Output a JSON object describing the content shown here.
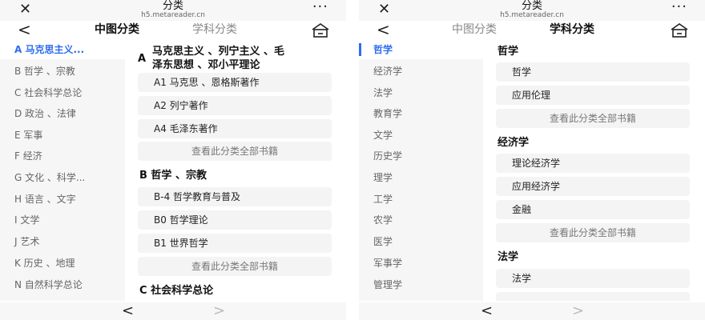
{
  "top": {
    "close_glyph": "✕",
    "title": "分类",
    "url": "h5.metareader.cn",
    "more_glyph": "···"
  },
  "nav": {
    "back_glyph": "<",
    "tab_cn": "中图分类",
    "tab_subject": "学科分类",
    "home_icon": "home-icon"
  },
  "bottom": {
    "prev_glyph": "<",
    "next_glyph": ">"
  },
  "left": {
    "sidebar": [
      "A 马克思主义...",
      "B 哲学 、宗教",
      "C 社会科学总论",
      "D 政治 、法律",
      "E 军事",
      "F 经济",
      "G 文化 、科学...",
      "H 语言 、文字",
      "I 文学",
      "J 艺术",
      "K 历史 、地理",
      "N 自然科学总论"
    ],
    "sec_a_line1": "马克思主义 、列宁主义 、毛",
    "sec_a_line2": "泽东思想 、邓小平理论",
    "sec_a_letter": "A",
    "sec_a_items": [
      "A1 马克思 、恩格斯著作",
      "A2 列宁著作",
      "A4 毛泽东著作"
    ],
    "view_all": "查看此分类全部书籍",
    "sec_b_title": "B 哲学 、宗教",
    "sec_b_items": [
      "B-4 哲学教育与普及",
      "B0 哲学理论",
      "B1 世界哲学"
    ],
    "sec_c_title": "C 社会科学总论"
  },
  "right": {
    "sidebar": [
      "哲学",
      "经济学",
      "法学",
      "教育学",
      "文学",
      "历史学",
      "理学",
      "工学",
      "农学",
      "医学",
      "军事学",
      "管理学"
    ],
    "sec1_title": "哲学",
    "sec1_items": [
      "哲学",
      "应用伦理"
    ],
    "sec2_title": "经济学",
    "sec2_items": [
      "理论经济学",
      "应用经济学",
      "金融"
    ],
    "sec3_title": "法学",
    "sec3_items": [
      "法学"
    ],
    "view_all": "查看此分类全部书籍"
  },
  "colors": {
    "accent": "#2d6cf0",
    "sidebar_bg": "#f6f6f6",
    "item_bg": "#f4f4f4"
  }
}
